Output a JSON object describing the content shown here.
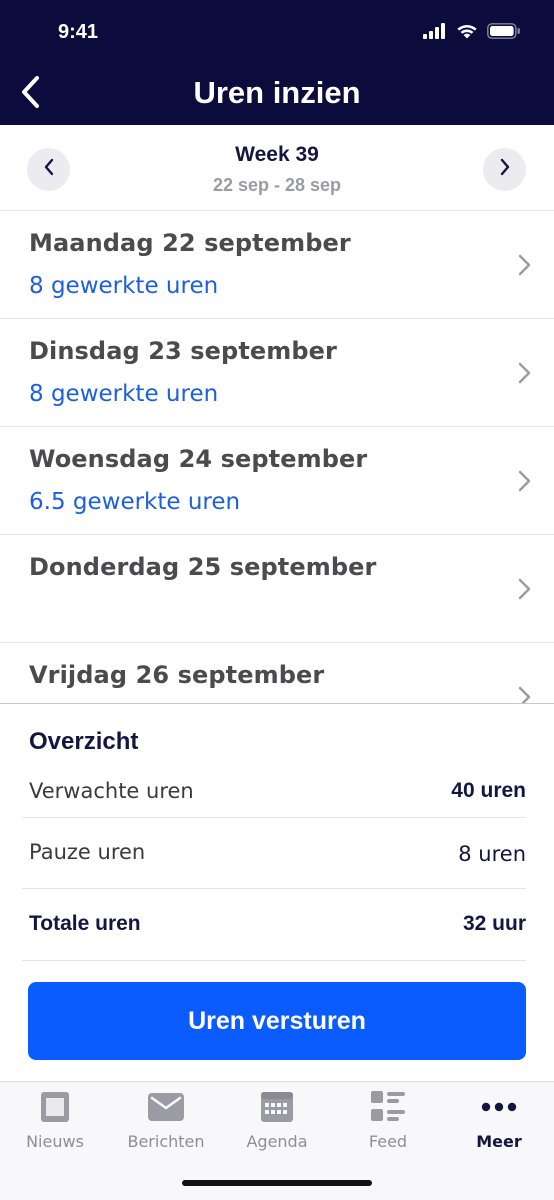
{
  "status_bar": {
    "time": "9:41"
  },
  "header": {
    "title": "Uren inzien",
    "back_icon": "chevron-left-icon"
  },
  "week": {
    "title": "Week 39",
    "range": "22 sep - 28 sep"
  },
  "days": [
    {
      "label": "Maandag 22 september",
      "hours": "8 gewerkte uren"
    },
    {
      "label": "Dinsdag 23 september",
      "hours": "8 gewerkte uren"
    },
    {
      "label": "Woensdag 24 september",
      "hours": "6.5 gewerkte uren"
    },
    {
      "label": "Donderdag 25 september",
      "hours": ""
    },
    {
      "label": "Vrijdag 26 september",
      "hours": ""
    }
  ],
  "summary": {
    "title": "Overzicht",
    "expected": {
      "label": "Verwachte uren",
      "value": "40 uren"
    },
    "break": {
      "label": "Pauze uren",
      "value": "8 uren"
    },
    "total": {
      "label": "Totale uren",
      "value": "32 uur"
    },
    "submit_label": "Uren versturen"
  },
  "tabs": [
    {
      "label": "Nieuws",
      "icon": "news-icon"
    },
    {
      "label": "Berichten",
      "icon": "envelope-icon"
    },
    {
      "label": "Agenda",
      "icon": "calendar-icon"
    },
    {
      "label": "Feed",
      "icon": "feed-icon"
    },
    {
      "label": "Meer",
      "icon": "more-dots-icon",
      "active": true
    }
  ],
  "colors": {
    "header_bg": "#0b0c3c",
    "accent": "#0b5cff",
    "link": "#1e5fdb"
  }
}
